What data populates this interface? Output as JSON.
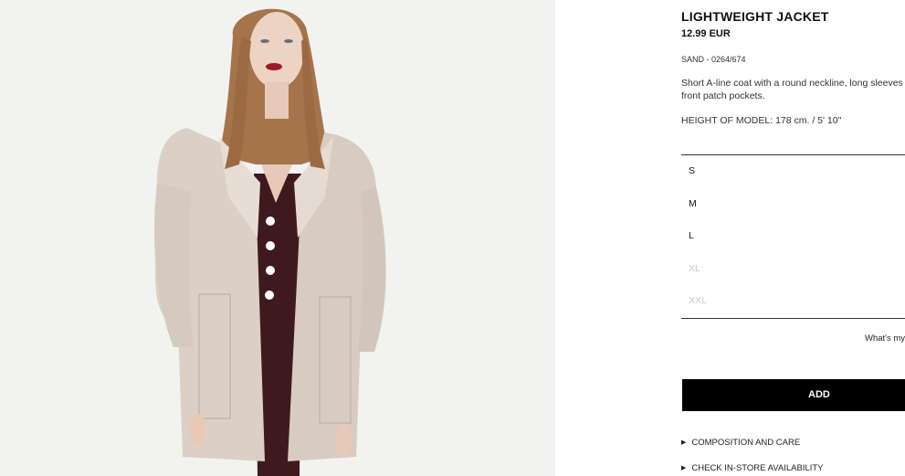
{
  "product": {
    "title": "LIGHTWEIGHT JACKET",
    "price": "12.99 EUR",
    "color_ref": "SAND - 0264/674",
    "description": "Short A-line coat with a round neckline, long sleeves and front patch pockets.",
    "model_height": "HEIGHT OF MODEL: 178 cm. / 5' 10\""
  },
  "sizes": [
    {
      "label": "S",
      "available": true
    },
    {
      "label": "M",
      "available": true
    },
    {
      "label": "L",
      "available": true
    },
    {
      "label": "XL",
      "available": false
    },
    {
      "label": "XXL",
      "available": false
    }
  ],
  "size_guide_label": "What's my size?",
  "add_button_label": "ADD",
  "links": {
    "composition": "COMPOSITION AND CARE",
    "store_availability": "CHECK IN-STORE AVAILABILITY"
  },
  "colors": {
    "jacket": "#dcd0c6",
    "dress": "#3e1a1f",
    "hair": "#a5744a",
    "button_bg": "#000000"
  }
}
